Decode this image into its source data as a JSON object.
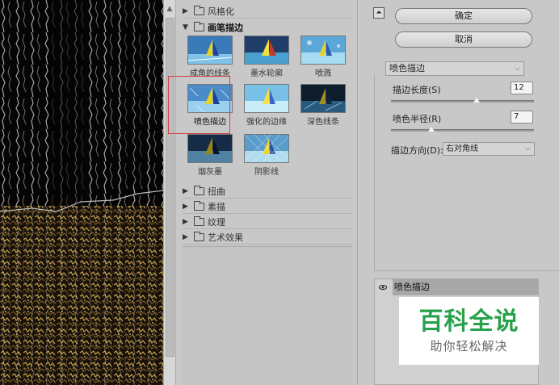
{
  "gallery": {
    "categories_top": [
      {
        "label": "风格化",
        "open": false
      }
    ],
    "open_category": {
      "label": "画笔描边",
      "open": true
    },
    "thumbnails": [
      {
        "label": "成角的线条"
      },
      {
        "label": "墨水轮廓"
      },
      {
        "label": "喷溅"
      },
      {
        "label": "喷色描边",
        "selected": true
      },
      {
        "label": "强化的边缘"
      },
      {
        "label": "深色线条"
      },
      {
        "label": "烟灰墨"
      },
      {
        "label": "阴影线"
      }
    ],
    "categories_bottom": [
      {
        "label": "扭曲"
      },
      {
        "label": "素描"
      },
      {
        "label": "纹理"
      },
      {
        "label": "艺术效果"
      }
    ]
  },
  "settings": {
    "ok_label": "确定",
    "cancel_label": "取消",
    "filter_select": "喷色描边",
    "params": [
      {
        "label": "描边长度(S)",
        "value": "12",
        "level": 0.6
      },
      {
        "label": "喷色半径(R)",
        "value": "7",
        "level": 0.28
      }
    ],
    "direction_label": "描边方向(D):",
    "direction_value": "右对角线"
  },
  "layers": {
    "layer_name": "喷色描边"
  },
  "watermark": {
    "title": "百科全说",
    "subtitle": "助你轻松解决"
  }
}
